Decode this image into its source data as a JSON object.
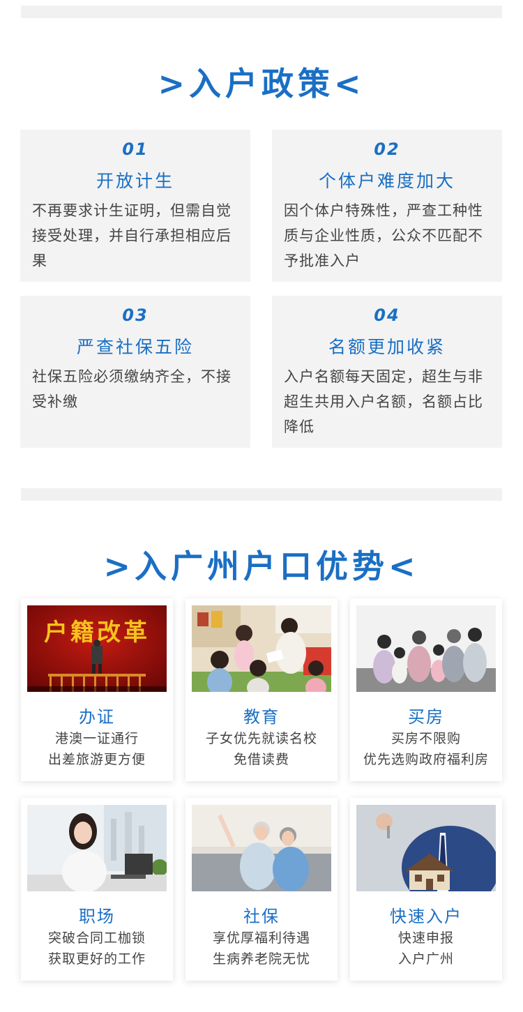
{
  "colors": {
    "accent": "#1a6fc4",
    "card_bg": "#f3f3f3",
    "divider": "#f1f1f1"
  },
  "policy": {
    "title": ">入户政策<",
    "items": [
      {
        "num": "01",
        "title": "开放计生",
        "desc": "不再要求计生证明，但需自觉接受处理，并自行承担相应后果"
      },
      {
        "num": "02",
        "title": "个体户难度加大",
        "desc": "因个体户特殊性，严查工种性质与企业性质，公众不匹配不予批准入户"
      },
      {
        "num": "03",
        "title": "严查社保五险",
        "desc": "社保五险必须缴纳齐全，不接受补缴"
      },
      {
        "num": "04",
        "title": "名额更加收紧",
        "desc": "入户名额每天固定，超生与非超生共用入户名额，名额占比降低"
      }
    ]
  },
  "advantages": {
    "title": ">入广州户口优势<",
    "items": [
      {
        "title": "办证",
        "line1": "港澳一证通行",
        "line2": "出差旅游更方便",
        "image_text": "户籍改革"
      },
      {
        "title": "教育",
        "line1": "子女优先就读名校",
        "line2": "免借读费"
      },
      {
        "title": "买房",
        "line1": "买房不限购",
        "line2": "优先选购政府福利房"
      },
      {
        "title": "职场",
        "line1": "突破合同工枷锁",
        "line2": "获取更好的工作"
      },
      {
        "title": "社保",
        "line1": "享优厚福利待遇",
        "line2": "生病养老院无忧"
      },
      {
        "title": "快速入户",
        "line1": "快速申报",
        "line2": "入户广州"
      }
    ]
  }
}
